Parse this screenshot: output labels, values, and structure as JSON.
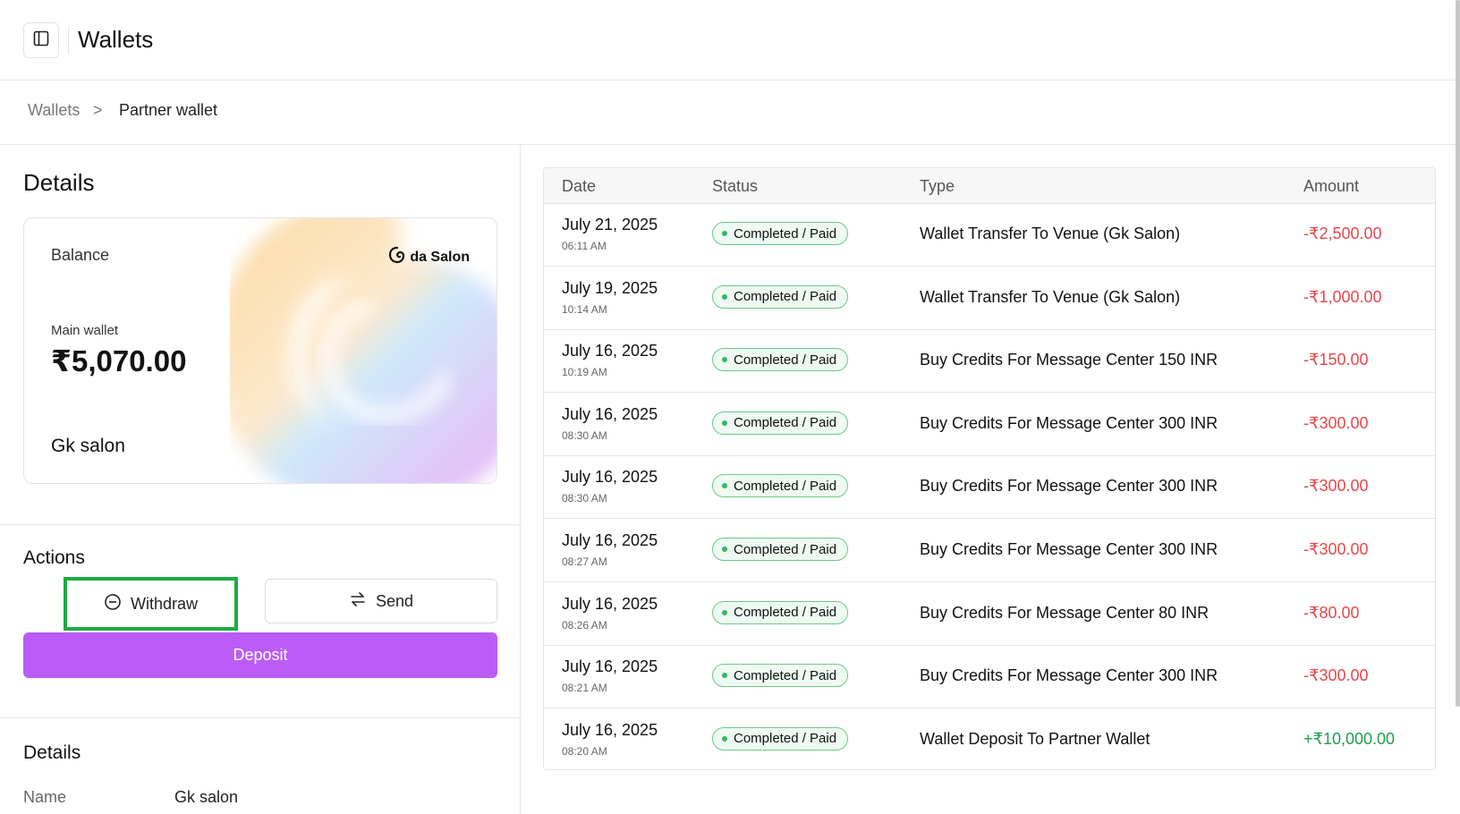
{
  "header": {
    "title": "Wallets",
    "toggle_icon": "sidebar-toggle-icon"
  },
  "breadcrumb": {
    "items": [
      "Wallets",
      "Partner wallet"
    ],
    "separator": ">"
  },
  "details": {
    "title": "Details",
    "card": {
      "balance_label": "Balance",
      "brand": "da Salon",
      "main_wallet_label": "Main wallet",
      "amount": "₹5,070.00",
      "owner": "Gk salon"
    }
  },
  "actions": {
    "title": "Actions",
    "withdraw_label": "Withdraw",
    "send_label": "Send",
    "deposit_label": "Deposit",
    "deposit_color": "#bb5cf7",
    "highlight_color": "#1faa42"
  },
  "details2": {
    "title": "Details",
    "name_label": "Name",
    "name_value": "Gk salon"
  },
  "transactions": {
    "columns": [
      "Date",
      "Status",
      "Type",
      "Amount"
    ],
    "rows": [
      {
        "date": "July 21, 2025",
        "time": "06:11 AM",
        "status": "Completed / Paid",
        "type": "Wallet Transfer To Venue (Gk Salon)",
        "amount": "-₹2,500.00",
        "sign": "neg"
      },
      {
        "date": "July 19, 2025",
        "time": "10:14 AM",
        "status": "Completed / Paid",
        "type": "Wallet Transfer To Venue (Gk Salon)",
        "amount": "-₹1,000.00",
        "sign": "neg"
      },
      {
        "date": "July 16, 2025",
        "time": "10:19 AM",
        "status": "Completed / Paid",
        "type": "Buy Credits For Message Center 150 INR",
        "amount": "-₹150.00",
        "sign": "neg"
      },
      {
        "date": "July 16, 2025",
        "time": "08:30 AM",
        "status": "Completed / Paid",
        "type": "Buy Credits For Message Center 300 INR",
        "amount": "-₹300.00",
        "sign": "neg"
      },
      {
        "date": "July 16, 2025",
        "time": "08:30 AM",
        "status": "Completed / Paid",
        "type": "Buy Credits For Message Center 300 INR",
        "amount": "-₹300.00",
        "sign": "neg"
      },
      {
        "date": "July 16, 2025",
        "time": "08:27 AM",
        "status": "Completed / Paid",
        "type": "Buy Credits For Message Center 300 INR",
        "amount": "-₹300.00",
        "sign": "neg"
      },
      {
        "date": "July 16, 2025",
        "time": "08:26 AM",
        "status": "Completed / Paid",
        "type": "Buy Credits For Message Center 80 INR",
        "amount": "-₹80.00",
        "sign": "neg"
      },
      {
        "date": "July 16, 2025",
        "time": "08:21 AM",
        "status": "Completed / Paid",
        "type": "Buy Credits For Message Center 300 INR",
        "amount": "-₹300.00",
        "sign": "neg"
      },
      {
        "date": "July 16, 2025",
        "time": "08:20 AM",
        "status": "Completed / Paid",
        "type": "Wallet Deposit To Partner Wallet",
        "amount": "+₹10,000.00",
        "sign": "pos"
      }
    ]
  }
}
